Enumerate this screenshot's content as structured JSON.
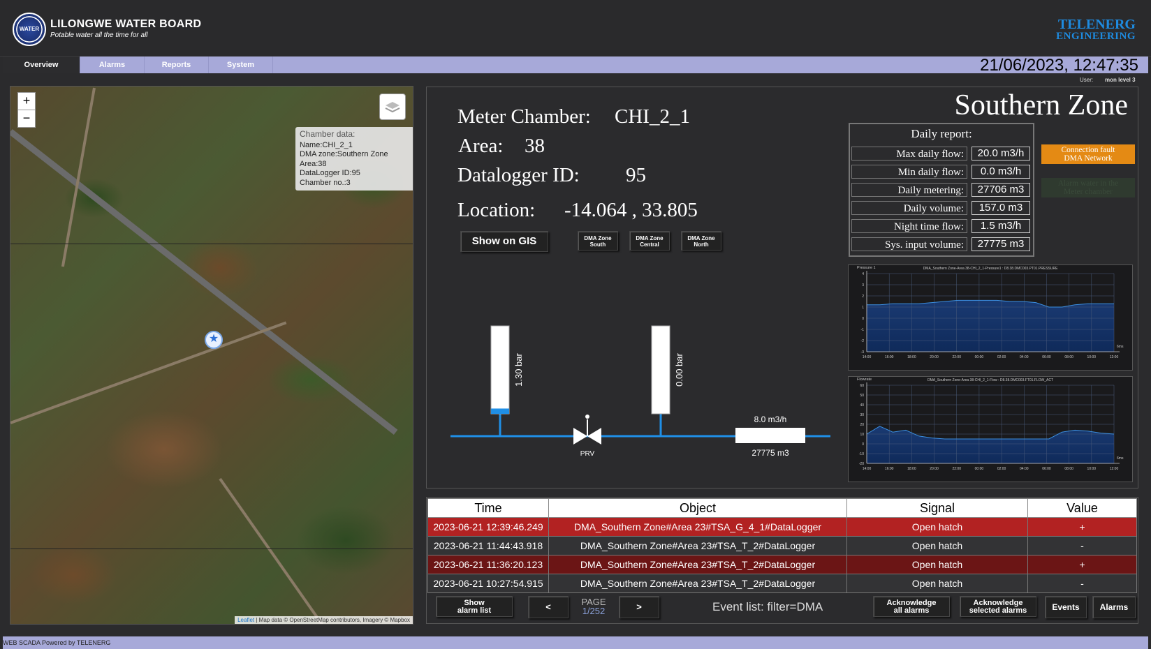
{
  "header": {
    "org_name": "LILONGWE WATER BOARD",
    "tagline": "Potable water all the time for all",
    "logo_text": "WATER",
    "brand_line1": "TELENERG",
    "brand_line2": "ENGINEERING"
  },
  "nav": {
    "tabs": [
      "Overview",
      "Alarms",
      "Reports",
      "System"
    ],
    "active": "Overview"
  },
  "datetime": "21/06/2023, 12:47:35",
  "user": {
    "label": "User:",
    "value": "mon level 3"
  },
  "map": {
    "zoom_in": "+",
    "zoom_out": "−",
    "popup_title": "Chamber data:",
    "popup_lines": [
      "Name:CHI_2_1",
      "DMA zone:Southern Zone",
      "Area:38",
      "DataLogger ID:95",
      "Chamber no.:3"
    ],
    "attribution_link": "Leaflet",
    "attribution": " | Map data © OpenStreetMap contributors, Imagery © Mapbox"
  },
  "panel": {
    "zone_title": "Southern Zone",
    "meter_chamber_label": "Meter Chamber:",
    "meter_chamber_value": "CHI_2_1",
    "area_label": "Area:",
    "area_value": "38",
    "datalogger_label": "Datalogger ID:",
    "datalogger_value": "95",
    "location_label": "Location:",
    "location_value": "-14.064 , 33.805",
    "show_gis": "Show on GIS",
    "dma_buttons": [
      [
        "DMA Zone",
        "South"
      ],
      [
        "DMA Zone",
        "Central"
      ],
      [
        "DMA Zone",
        "North"
      ]
    ],
    "gauge1": {
      "label": "1.30 bar",
      "fill": 0.06
    },
    "gauge2": {
      "label": "0.00 bar",
      "fill": 0
    },
    "prv_label": "PRV",
    "flow_rate": "8.0 m3/h",
    "flow_total": "27775 m3",
    "report_title": "Daily report:",
    "report": [
      {
        "label": "Max daily flow:",
        "value": "20.0 m3/h"
      },
      {
        "label": "Min daily flow:",
        "value": "0.0 m3/h"
      },
      {
        "label": "Daily metering:",
        "value": "27706 m3"
      },
      {
        "label": "Daily volume:",
        "value": "157.0 m3"
      },
      {
        "label": "Night time flow:",
        "value": "1.5 m3/h"
      },
      {
        "label": "Sys. input volume:",
        "value": "27775 m3"
      }
    ],
    "conn_fault": [
      "Connection fault",
      "DMA Network"
    ],
    "alarm_water": [
      "Alarm water in the",
      "Meter chamber"
    ],
    "colors": {
      "accent": "#1e8be0",
      "fault": "#e48a14",
      "pipe": "#1f8fe6"
    }
  },
  "charts": [
    {
      "name": "Pressure 1",
      "title": "DMA_Southern Zone-Area 38-CHI_2_1-Pressure1 : D8.38.DMC003.PT01.PRESSURE",
      "x_ticks": [
        "14:00",
        "16:00",
        "18:00",
        "20:00",
        "22:00",
        "00:00",
        "02:00",
        "04:00",
        "06:00",
        "08:00",
        "10:00",
        "12:00"
      ],
      "y_ticks": [
        "4",
        "3",
        "2",
        "1",
        "0",
        "-1",
        "-2",
        "-3"
      ],
      "unit": "6ms",
      "values": [
        1.2,
        1.2,
        1.3,
        1.3,
        1.3,
        1.4,
        1.5,
        1.6,
        1.6,
        1.6,
        1.6,
        1.5,
        1.5,
        1.4,
        1.0,
        1.0,
        1.2,
        1.3,
        1.3,
        1.3
      ]
    },
    {
      "name": "Flowrate",
      "title": "DMA_Southern Zone-Area 38-CHI_2_1-Flow : D8.38.DMC003.FT01.FLOW_ACT",
      "x_ticks": [
        "14:00",
        "16:00",
        "18:00",
        "20:00",
        "22:00",
        "00:00",
        "02:00",
        "04:00",
        "06:00",
        "08:00",
        "10:00",
        "12:00"
      ],
      "y_ticks": [
        "60",
        "50",
        "40",
        "30",
        "20",
        "10",
        "0",
        "-10",
        "-20"
      ],
      "unit": "6ms",
      "values": [
        10,
        18,
        12,
        14,
        8,
        6,
        5,
        5,
        5,
        5,
        5,
        5,
        5,
        5,
        5,
        12,
        14,
        13,
        11,
        10
      ]
    }
  ],
  "events": {
    "headers": [
      "Time",
      "Object",
      "Signal",
      "Value"
    ],
    "rows": [
      [
        "2023-06-21 12:39:46.249",
        "DMA_Southern Zone#Area 23#TSA_G_4_1#DataLogger",
        "Open hatch",
        "+"
      ],
      [
        "2023-06-21 11:44:43.918",
        "DMA_Southern Zone#Area 23#TSA_T_2#DataLogger",
        "Open hatch",
        "-"
      ],
      [
        "2023-06-21 11:36:20.123",
        "DMA_Southern Zone#Area 23#TSA_T_2#DataLogger",
        "Open hatch",
        "+"
      ],
      [
        "2023-06-21 10:27:54.915",
        "DMA_Southern Zone#Area 23#TSA_T_2#DataLogger",
        "Open hatch",
        "-"
      ]
    ],
    "show_list": [
      "Show",
      "alarm list"
    ],
    "prev": "<",
    "next": ">",
    "page_label": "PAGE",
    "page_value": "1/252",
    "filter_text": "Event list: filter=DMA",
    "ack_all": [
      "Acknowledge",
      "all alarms"
    ],
    "ack_selected": [
      "Acknowledge",
      "selected alarms"
    ],
    "events_btn": "Events",
    "alarms_btn": "Alarms"
  },
  "footer": "WEB SCADA Powered by TELENERG"
}
